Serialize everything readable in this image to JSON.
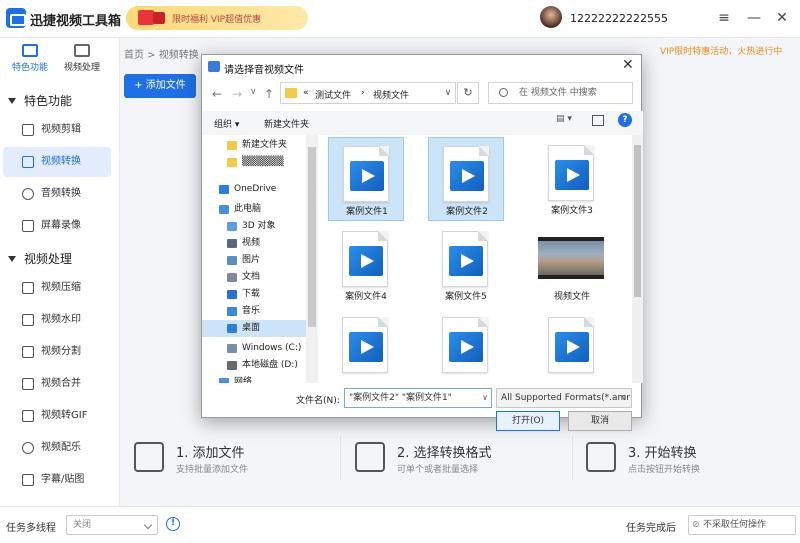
{
  "app": {
    "title": "迅捷视频工具箱",
    "username": "12222222222555",
    "promo_text": "限时福利 VIP超值优惠"
  },
  "window_controls": [
    "≡",
    "—",
    "✕"
  ],
  "sidebar": {
    "tabs": [
      {
        "label": "特色功能"
      },
      {
        "label": "视频处理"
      }
    ],
    "section1": "特色功能",
    "items1": [
      {
        "label": "视频剪辑"
      },
      {
        "label": "视频转换"
      },
      {
        "label": "音频转换"
      },
      {
        "label": "屏幕录像"
      }
    ],
    "section2": "视频处理",
    "items2": [
      {
        "label": "视频压缩"
      },
      {
        "label": "视频水印"
      },
      {
        "label": "视频分割"
      },
      {
        "label": "视频合并"
      },
      {
        "label": "视频转GIF"
      },
      {
        "label": "视频配乐"
      },
      {
        "label": "字幕/贴图"
      }
    ]
  },
  "main": {
    "breadcrumb": "首页 > 视频转换",
    "vip_banner": "VIP限时特惠活动，火热进行中",
    "add_file_label": "+ 添加文件",
    "steps": [
      {
        "title": "1. 添加文件",
        "desc": "支持批量添加文件"
      },
      {
        "title": "2. 选择转换格式",
        "desc": "可单个或者批量选择"
      },
      {
        "title": "3. 开始转换",
        "desc": "点击按钮开始转换"
      }
    ]
  },
  "bottom": {
    "multi_label": "任务多线程",
    "multi_value": "关闭",
    "after_label": "任务完成后",
    "after_value": "不采取任何操作"
  },
  "dialog": {
    "title": "请选择音视频文件",
    "close": "✕",
    "nav": {
      "back": "←",
      "forward": "→",
      "dropdown": "∨",
      "up": "↑"
    },
    "address": {
      "prefix": "«",
      "part1": "测试文件",
      "sep": "›",
      "part2": "视频文件"
    },
    "search_placeholder": "在 视频文件 中搜索",
    "toolbar": {
      "organize": "组织 ▾",
      "new_folder": "新建文件夹",
      "view": "▤ ▾",
      "help": "?"
    },
    "nav_items": [
      {
        "label": "新建文件夹",
        "color": "#f2c94c"
      },
      {
        "label": "▒▒▒▒▒▒",
        "color": "#f2c94c"
      },
      {
        "label": "OneDrive",
        "color": "#2d7fdb"
      },
      {
        "label": "此电脑",
        "color": "#4a90d9"
      },
      {
        "label": "3D 对象",
        "color": "#5aa0e0"
      },
      {
        "label": "视频",
        "color": "#5a6b7d"
      },
      {
        "label": "图片",
        "color": "#5a8fbf"
      },
      {
        "label": "文档",
        "color": "#7e8c9a"
      },
      {
        "label": "下载",
        "color": "#2d6fd1"
      },
      {
        "label": "音乐",
        "color": "#3a8ad6"
      },
      {
        "label": "桌面",
        "color": "#2f7dd7"
      },
      {
        "label": "Windows (C:)",
        "color": "#7b8ea3"
      },
      {
        "label": "本地磁盘 (D:)",
        "color": "#6a6a6a"
      },
      {
        "label": "网络",
        "color": "#4a90d9"
      }
    ],
    "files": [
      {
        "name": "案例文件1",
        "selected": true,
        "type": "video"
      },
      {
        "name": "案例文件2",
        "selected": true,
        "type": "video"
      },
      {
        "name": "案例文件3",
        "selected": false,
        "type": "video"
      },
      {
        "name": "案例文件4",
        "selected": false,
        "type": "video"
      },
      {
        "name": "案例文件5",
        "selected": false,
        "type": "video"
      },
      {
        "name": "视频文件",
        "selected": false,
        "type": "thumb"
      },
      {
        "name": "",
        "selected": false,
        "type": "video"
      },
      {
        "name": "",
        "selected": false,
        "type": "video"
      },
      {
        "name": "",
        "selected": false,
        "type": "video"
      }
    ],
    "filename_label": "文件名(N):",
    "filename_value": "\"案例文件2\" \"案例文件1\"",
    "filter_value": "All Supported Formats(*.amr",
    "open_label": "打开(O)",
    "cancel_label": "取消"
  }
}
